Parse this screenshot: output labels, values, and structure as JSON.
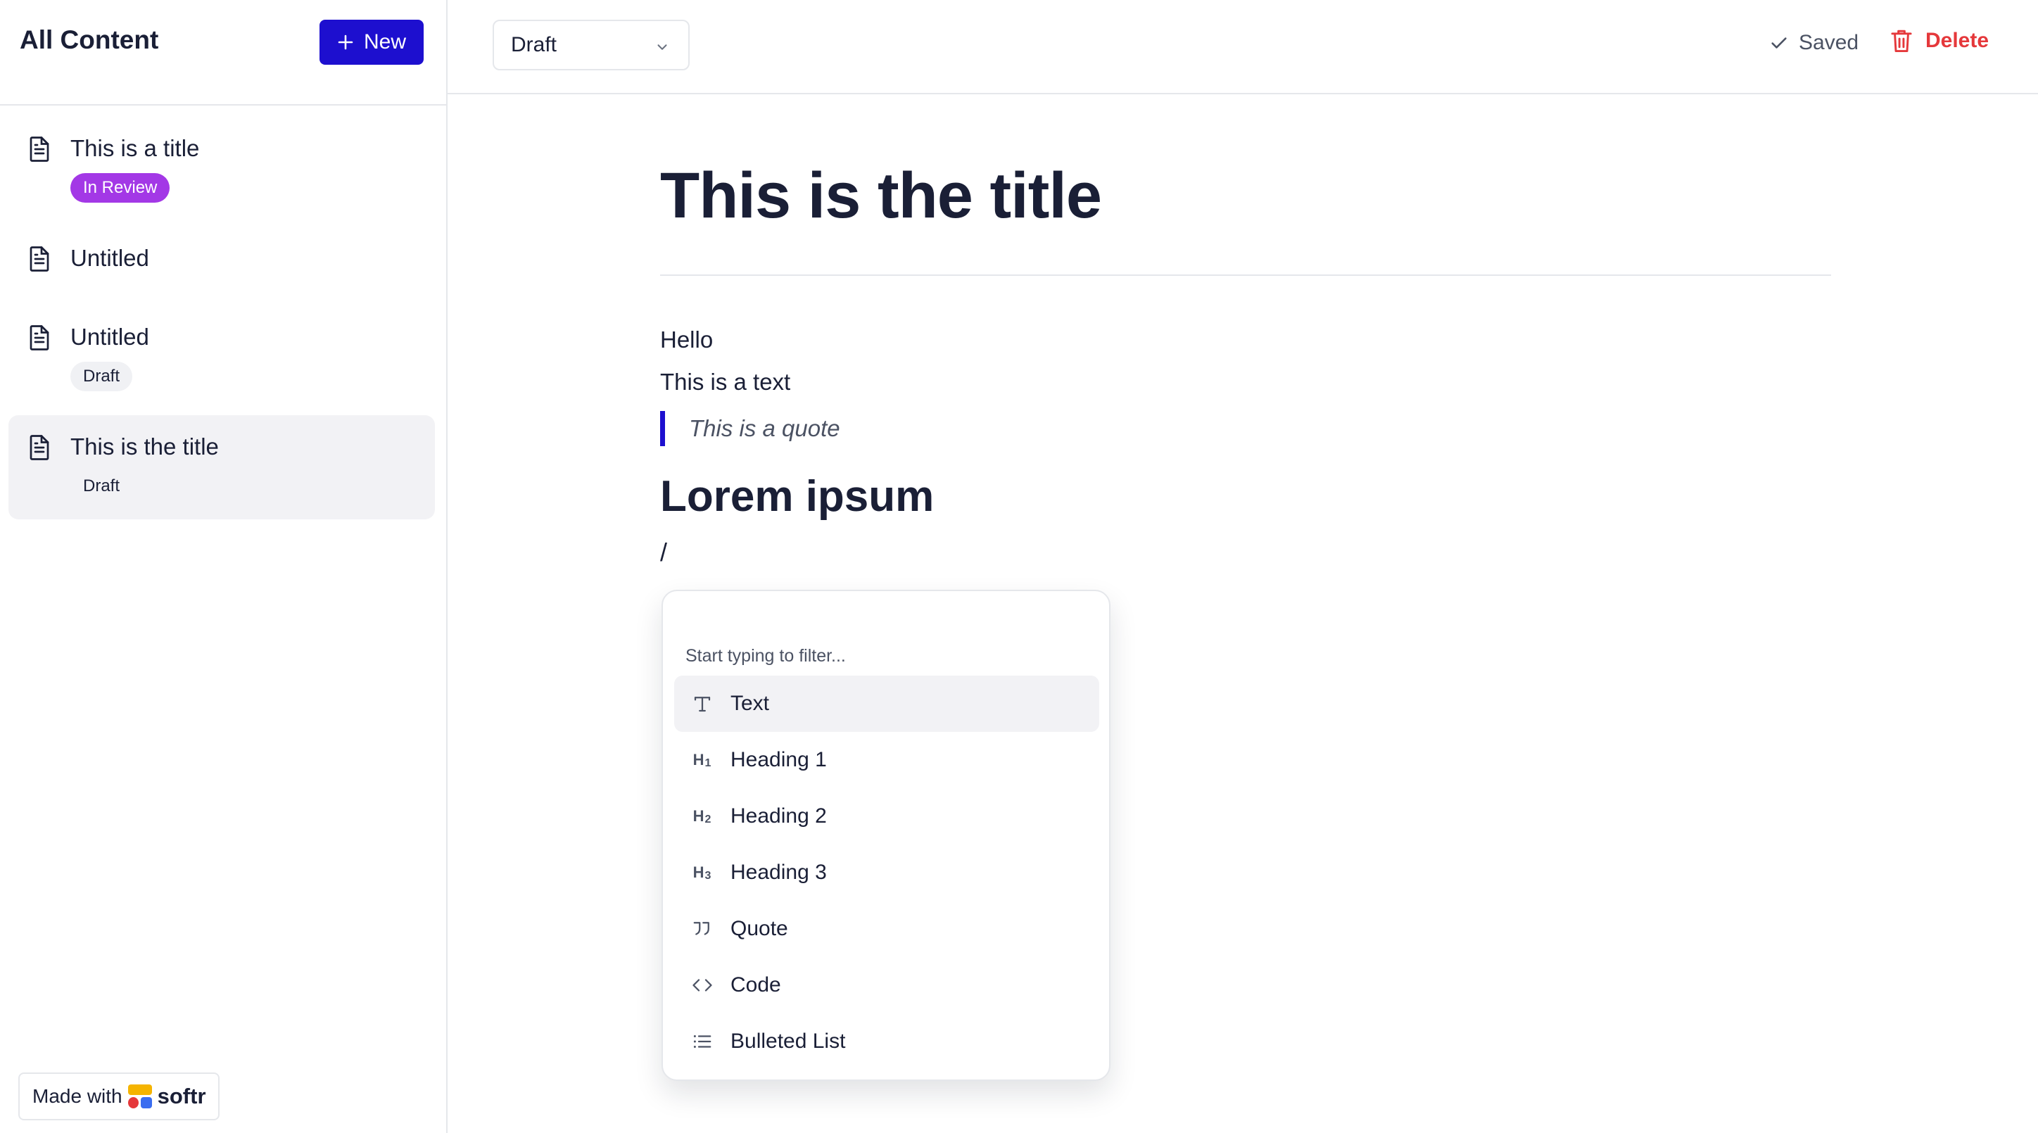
{
  "sidebar": {
    "title": "All Content",
    "new_button": "New",
    "items": [
      {
        "title": "This is a title",
        "status": "In Review"
      },
      {
        "title": "Untitled",
        "status": ""
      },
      {
        "title": "Untitled",
        "status": "Draft"
      },
      {
        "title": "This is the title",
        "status": "Draft",
        "active": true
      }
    ],
    "made_with": "Made with",
    "brand": "softr"
  },
  "topbar": {
    "status_value": "Draft",
    "saved_label": "Saved",
    "delete_label": "Delete"
  },
  "editor": {
    "title": "This is the title",
    "paragraphs": [
      "Hello",
      "This is a text"
    ],
    "quote": "This is a quote",
    "heading": "Lorem ipsum",
    "slash": "/"
  },
  "slash_menu": {
    "hint": "Start typing to filter...",
    "items": [
      {
        "label": "Text",
        "icon": "text-icon"
      },
      {
        "label": "Heading 1",
        "icon": "heading-1-icon"
      },
      {
        "label": "Heading 2",
        "icon": "heading-2-icon"
      },
      {
        "label": "Heading 3",
        "icon": "heading-3-icon"
      },
      {
        "label": "Quote",
        "icon": "quote-icon"
      },
      {
        "label": "Code",
        "icon": "code-icon"
      },
      {
        "label": "Bulleted List",
        "icon": "bulleted-list-icon"
      }
    ]
  },
  "colors": {
    "primary": "#1d0fcf",
    "review_badge": "#a338e6",
    "danger": "#e5383b",
    "text": "#1a1f36"
  }
}
